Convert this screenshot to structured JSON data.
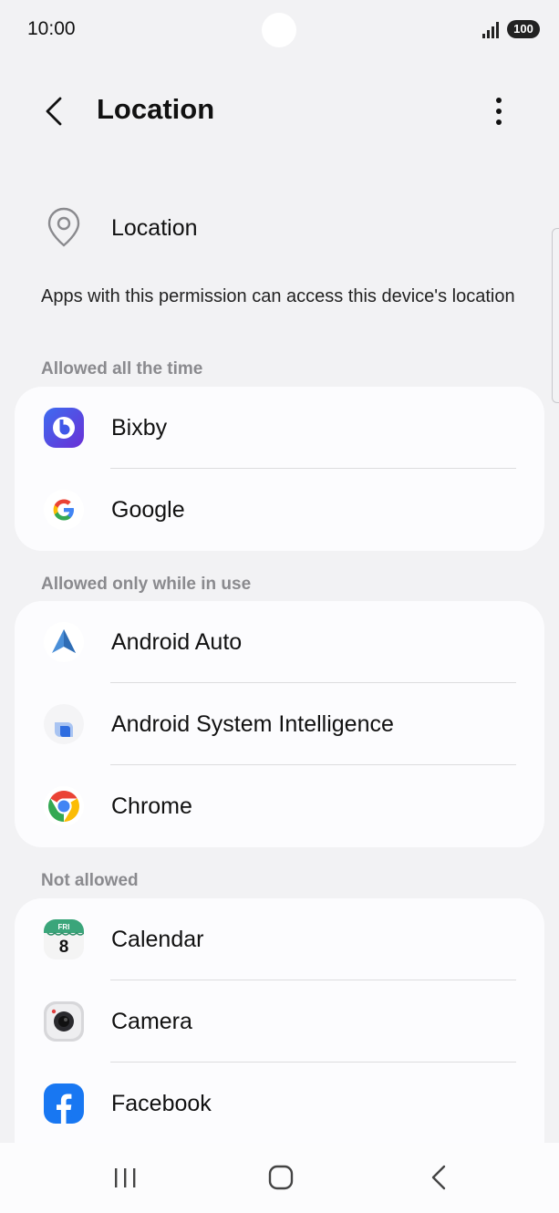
{
  "status_bar": {
    "time": "10:00",
    "battery": "100"
  },
  "header": {
    "title": "Location",
    "back_icon": "chevron-left-icon",
    "more_icon": "more-vertical-icon"
  },
  "permission": {
    "label": "Location",
    "icon": "location-pin-icon"
  },
  "description": "Apps with this permission can access this device's location",
  "sections": [
    {
      "title": "Allowed all the time",
      "apps": [
        {
          "name": "Bixby",
          "icon": "bixby-icon"
        },
        {
          "name": "Google",
          "icon": "google-icon"
        }
      ]
    },
    {
      "title": "Allowed only while in use",
      "apps": [
        {
          "name": "Android Auto",
          "icon": "android-auto-icon"
        },
        {
          "name": "Android System Intelligence",
          "icon": "android-system-intelligence-icon"
        },
        {
          "name": "Chrome",
          "icon": "chrome-icon"
        }
      ]
    },
    {
      "title": "Not allowed",
      "apps": [
        {
          "name": "Calendar",
          "icon": "calendar-icon",
          "icon_text_day": "FRI",
          "icon_text_date": "8"
        },
        {
          "name": "Camera",
          "icon": "camera-icon"
        },
        {
          "name": "Facebook",
          "icon": "facebook-icon"
        }
      ]
    }
  ],
  "nav_bar": {
    "recents_icon": "recents-icon",
    "home_icon": "home-icon",
    "back_icon": "back-icon"
  },
  "colors": {
    "background": "#f2f2f4",
    "card": "#fcfcfe",
    "section_header": "#8a8a8e",
    "facebook_blue": "#1877f2"
  }
}
